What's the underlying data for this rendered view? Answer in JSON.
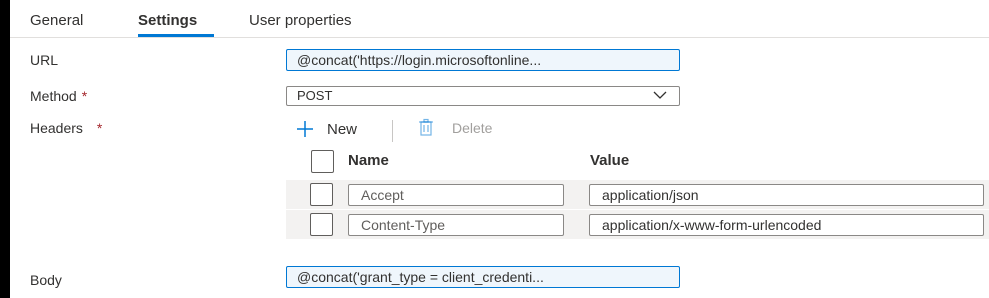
{
  "tabs": [
    {
      "label": "General"
    },
    {
      "label": "Settings"
    },
    {
      "label": "User properties"
    }
  ],
  "active_tab": "Settings",
  "form": {
    "url": {
      "label": "URL",
      "value": "@concat('https://login.microsoftonline..."
    },
    "method": {
      "label": "Method",
      "required_mark": "*",
      "value": "POST"
    },
    "headers": {
      "label": "Headers",
      "required_mark": "*",
      "new_label": "New",
      "delete_label": "Delete",
      "columns": {
        "name": "Name",
        "value": "Value"
      },
      "rows": [
        {
          "name": "Accept",
          "value": "application/json"
        },
        {
          "name": "Content-Type",
          "value": "application/x-www-form-urlencoded"
        }
      ]
    },
    "body": {
      "label": "Body",
      "value": "@concat('grant_type = client_credenti..."
    }
  },
  "colors": {
    "accent": "#0078d4",
    "required": "#a4262c",
    "disabled": "#a19f9d",
    "row_bg": "#f3f2f1"
  },
  "icons": {
    "new": "plus-icon",
    "delete": "trash-icon",
    "dropdown": "chevron-down-icon"
  }
}
